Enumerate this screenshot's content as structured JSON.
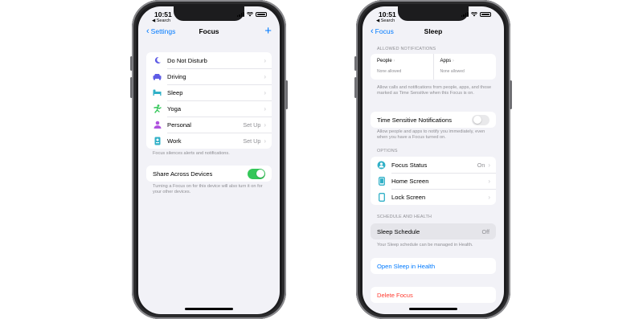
{
  "left_phone": {
    "status": {
      "time": "10:51",
      "sub": "◀ Search"
    },
    "nav": {
      "back": "Settings",
      "title": "Focus",
      "plus": "+"
    },
    "focus_items": [
      {
        "label": "Do Not Disturb",
        "value": "",
        "icon": "moon-icon",
        "color": "#5e5ce6"
      },
      {
        "label": "Driving",
        "value": "",
        "icon": "car-icon",
        "color": "#5e5ce6"
      },
      {
        "label": "Sleep",
        "value": "",
        "icon": "bed-icon",
        "color": "#30b0c7"
      },
      {
        "label": "Yoga",
        "value": "",
        "icon": "yoga-icon",
        "color": "#34c759"
      },
      {
        "label": "Personal",
        "value": "Set Up",
        "icon": "person-icon",
        "color": "#af52de"
      },
      {
        "label": "Work",
        "value": "Set Up",
        "icon": "badge-icon",
        "color": "#30b0c7"
      }
    ],
    "focus_note": "Focus silences alerts and notifications.",
    "share_label": "Share Across Devices",
    "share_on": true,
    "share_note": "Turning a Focus on for this device will also turn it on for your other devices."
  },
  "right_phone": {
    "status": {
      "time": "10:51",
      "sub": "◀ Search"
    },
    "nav": {
      "back": "Focus",
      "title": "Sleep"
    },
    "allowed_header": "ALLOWED NOTIFICATIONS",
    "people_label": "People",
    "people_value": "None allowed",
    "apps_label": "Apps",
    "apps_value": "None allowed",
    "allowed_note": "Allow calls and notifications from people, apps, and those marked as Time Sensitive when this Focus is on.",
    "time_sensitive_label": "Time Sensitive Notifications",
    "time_sensitive_on": false,
    "time_sensitive_note": "Allow people and apps to notify you immediately, even when you have a Focus turned on.",
    "options_header": "OPTIONS",
    "options": [
      {
        "label": "Focus Status",
        "value": "On",
        "icon": "focus-status-icon"
      },
      {
        "label": "Home Screen",
        "value": "",
        "icon": "home-screen-icon"
      },
      {
        "label": "Lock Screen",
        "value": "",
        "icon": "lock-screen-icon"
      }
    ],
    "schedule_header": "SCHEDULE AND HEALTH",
    "sleep_schedule_label": "Sleep Schedule",
    "sleep_schedule_value": "Off",
    "schedule_note": "Your Sleep schedule can be managed in Health.",
    "open_health": "Open Sleep in Health",
    "delete_focus": "Delete Focus"
  },
  "colors": {
    "accent": "#007aff",
    "toggle_on": "#34c759",
    "destructive": "#ff3b30",
    "teal": "#30b0c7"
  }
}
